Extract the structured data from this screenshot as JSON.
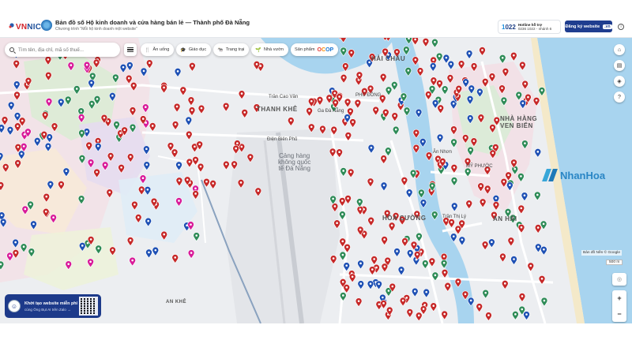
{
  "header": {
    "logo_text_a": "VN",
    "logo_text_b": "NIC",
    "title": "Bản đồ số Hộ kinh doanh và cửa hàng bán lẻ — Thành phố Đà Nẵng",
    "subtitle": "Chương trình \"Mỗi hộ kinh doanh một website\"",
    "hotline_a": "1",
    "hotline_b": "022",
    "hotline_label": "Hotline hỗ trợ",
    "hotline_detail": "0236 1022 - nhánh 6",
    "register_label": "Đăng ký website",
    "register_badge": ".vn",
    "info_glyph": "i"
  },
  "search": {
    "placeholder": "Tìm tên, địa chỉ, mã số thuế..."
  },
  "categories": [
    {
      "icon": "fork-knife-icon",
      "glyph": "🍴",
      "label": "Ăn uống"
    },
    {
      "icon": "education-icon",
      "glyph": "🎓",
      "label": "Giáo dục"
    },
    {
      "icon": "farm-icon",
      "glyph": "🐄",
      "label": "Trang trại"
    },
    {
      "icon": "garden-icon",
      "glyph": "🌱",
      "label": "Nhà vườn"
    },
    {
      "icon": "ocop-icon",
      "glyph": "",
      "label": "Sản phẩm"
    }
  ],
  "ocop": {
    "o1": "O",
    "o2": "C",
    "o3": "OP"
  },
  "map_labels": {
    "thanh_khe": "THANH KHÊ",
    "hai_chau": "HẢI CHÂU",
    "hoa_cuong": "HÒA CƯỜNG",
    "an_hai": "AN HẢI",
    "nhang_bien": "NHÀ HÀNG\nVEN BIỂN",
    "an_khe": "AN KHÊ",
    "airport": "Cảng hàng\nkhông quốc\ntế Đà Nẵng",
    "tran_cao_van": "Trần Cao Vân",
    "dien_bien_phu": "Điện Biên Phủ",
    "ga_da_nang": "Ga Đà Nẵng",
    "phu_dong": "PHÚ ĐỒNG",
    "my_phuoc": "MỸ PHƯỚC",
    "sa_ne": "Ân Nhơn",
    "tran_thi_ly": "Trần Thị Lý"
  },
  "brand_watermark": "NhanHoa",
  "map_data": "Bản đồ Nền © Google",
  "scale": "500 m",
  "zoom_in": "+",
  "zoom_out": "−",
  "promo": {
    "title": "Khởi tạo website miễn phí",
    "subtitle": "cùng Ông Bụt AI trên Zalo →"
  },
  "colors": {
    "pin_red": "#c62828",
    "pin_blue": "#1e50b4",
    "pin_green": "#2e8b57",
    "pin_pink": "#d81b99",
    "water": "#a8d4ef",
    "brand_blue": "#1f3d8f"
  }
}
